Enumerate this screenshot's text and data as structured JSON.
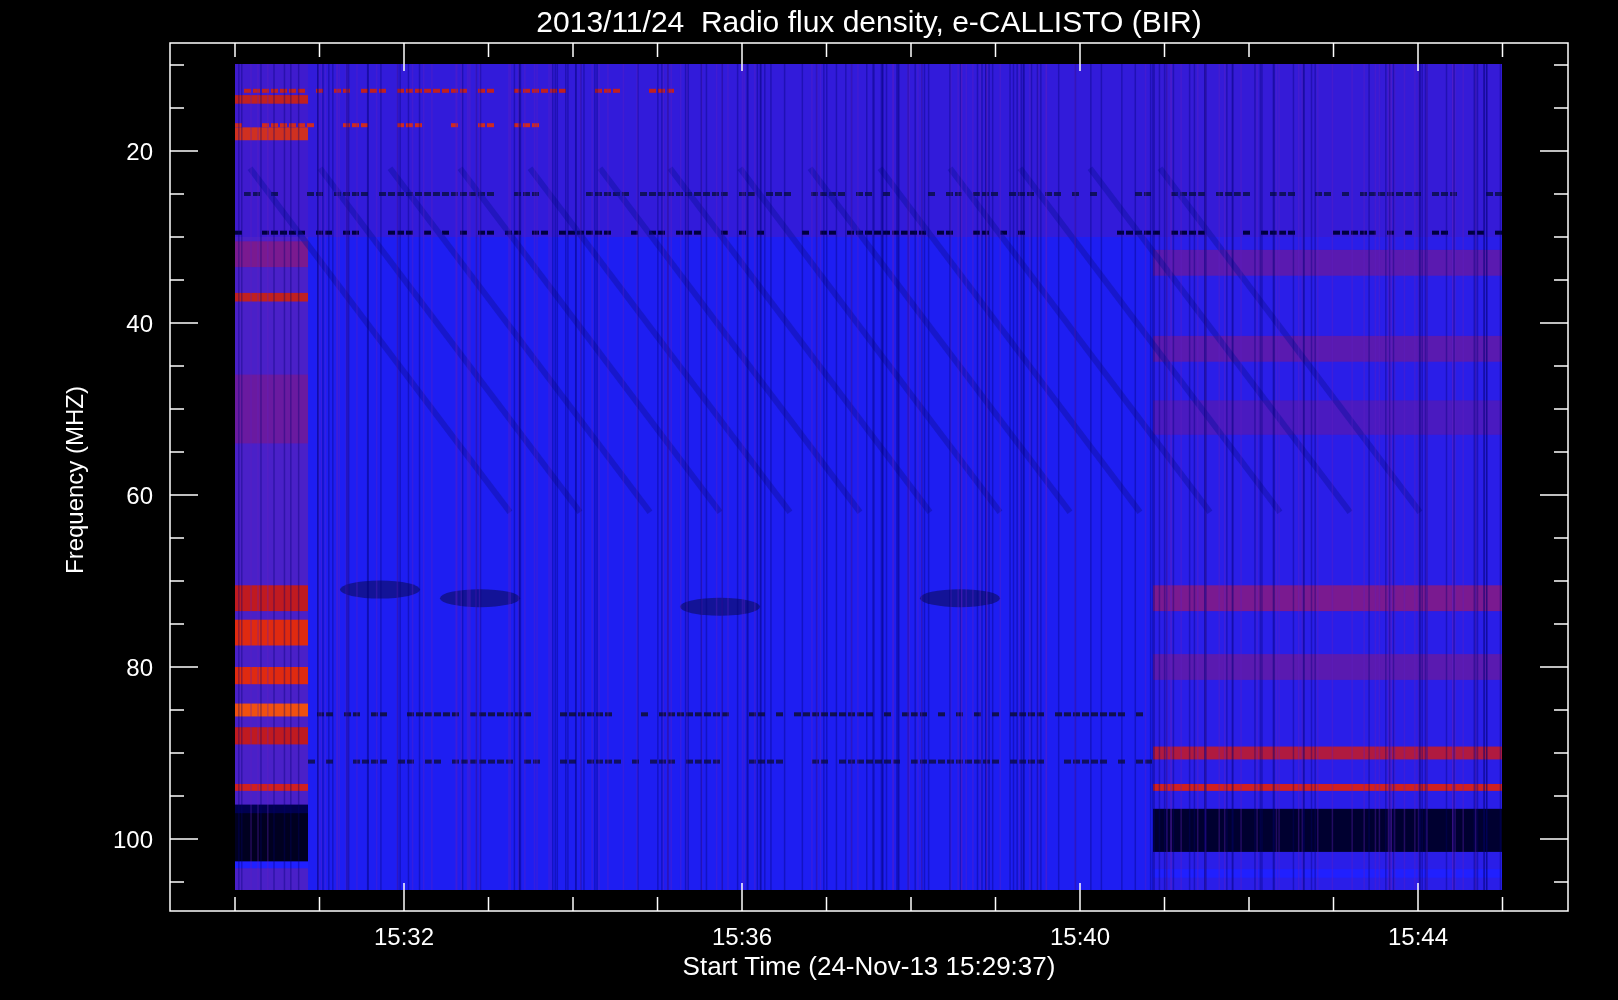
{
  "title": "2013/11/24  Radio flux density, e-CALLISTO (BIR)",
  "y_axis": {
    "label": "Frequency (MHZ)",
    "ticks": [
      "20",
      "40",
      "60",
      "80",
      "100"
    ]
  },
  "x_axis": {
    "label": "Start Time (24-Nov-13 15:29:37)",
    "ticks": [
      "15:32",
      "15:36",
      "15:40",
      "15:44"
    ]
  }
}
